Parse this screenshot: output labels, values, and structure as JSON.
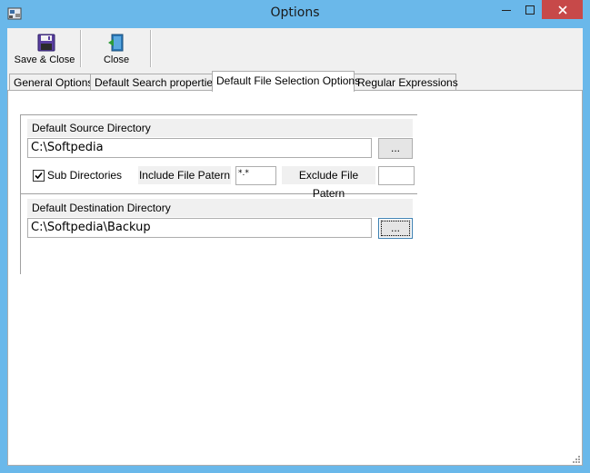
{
  "window": {
    "title": "Options"
  },
  "toolbar": {
    "save_close_label": "Save & Close",
    "close_label": "Close"
  },
  "tabs": [
    {
      "label": "General Options"
    },
    {
      "label": "Default Search properties"
    },
    {
      "label": "Default File Selection Options"
    },
    {
      "label": "Regular Expressions"
    }
  ],
  "source": {
    "header": "Default Source Directory",
    "path": "C:\\Softpedia",
    "browse_label": "...",
    "sub_directories_label": "Sub Directories",
    "sub_directories_checked": true,
    "include_label": "Include File Patern",
    "include_value": "*.*",
    "exclude_label": "Exclude File Patern",
    "exclude_value": ""
  },
  "destination": {
    "header": "Default Destination Directory",
    "path": "C:\\Softpedia\\Backup",
    "browse_label": "..."
  },
  "colors": {
    "titlebar": "#6ab8ea",
    "close_button": "#c74949",
    "panel": "#ffffff",
    "chrome": "#f0f0f0"
  }
}
